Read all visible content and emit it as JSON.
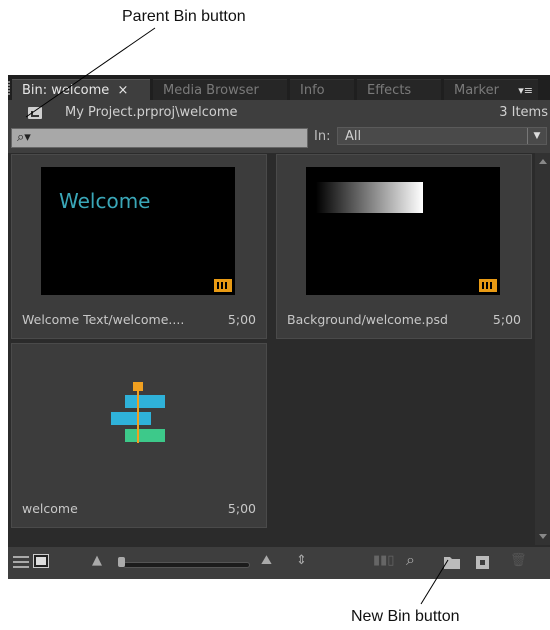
{
  "callouts": {
    "parent_bin": "Parent Bin button",
    "new_bin": "New Bin button"
  },
  "tabs": [
    {
      "label": "Bin: welcome",
      "close": "×",
      "active": true
    },
    {
      "label": "Media Browser"
    },
    {
      "label": "Info"
    },
    {
      "label": "Effects"
    },
    {
      "label": "Marker"
    }
  ],
  "tab_menu_icon": "panel-menu-icon",
  "path": "My Project.prproj\\welcome",
  "item_count": "3 Items",
  "search": {
    "icon": "search-icon",
    "value": ""
  },
  "in_filter": {
    "label": "In:",
    "selected": "All"
  },
  "items": [
    {
      "name": "Welcome Text/welcome....",
      "duration": "5;00",
      "thumb_text": "Welcome"
    },
    {
      "name": "Background/welcome.psd",
      "duration": "5;00"
    },
    {
      "name": "welcome",
      "duration": "5;00"
    }
  ],
  "colors": {
    "panel_bg": "#2b2b2b",
    "accent_teal": "#3aa7b8",
    "film_badge": "#e89a14",
    "sequence_blue": "#2fb2d9",
    "sequence_green": "#3dc98a"
  },
  "toolbar_icons": [
    "list-view-icon",
    "icon-view-icon",
    "zoom-out-icon",
    "zoom-slider",
    "zoom-in-icon",
    "sort-icon",
    "automate-to-sequence-icon",
    "find-icon",
    "new-bin-icon",
    "new-item-icon",
    "clear-icon"
  ]
}
